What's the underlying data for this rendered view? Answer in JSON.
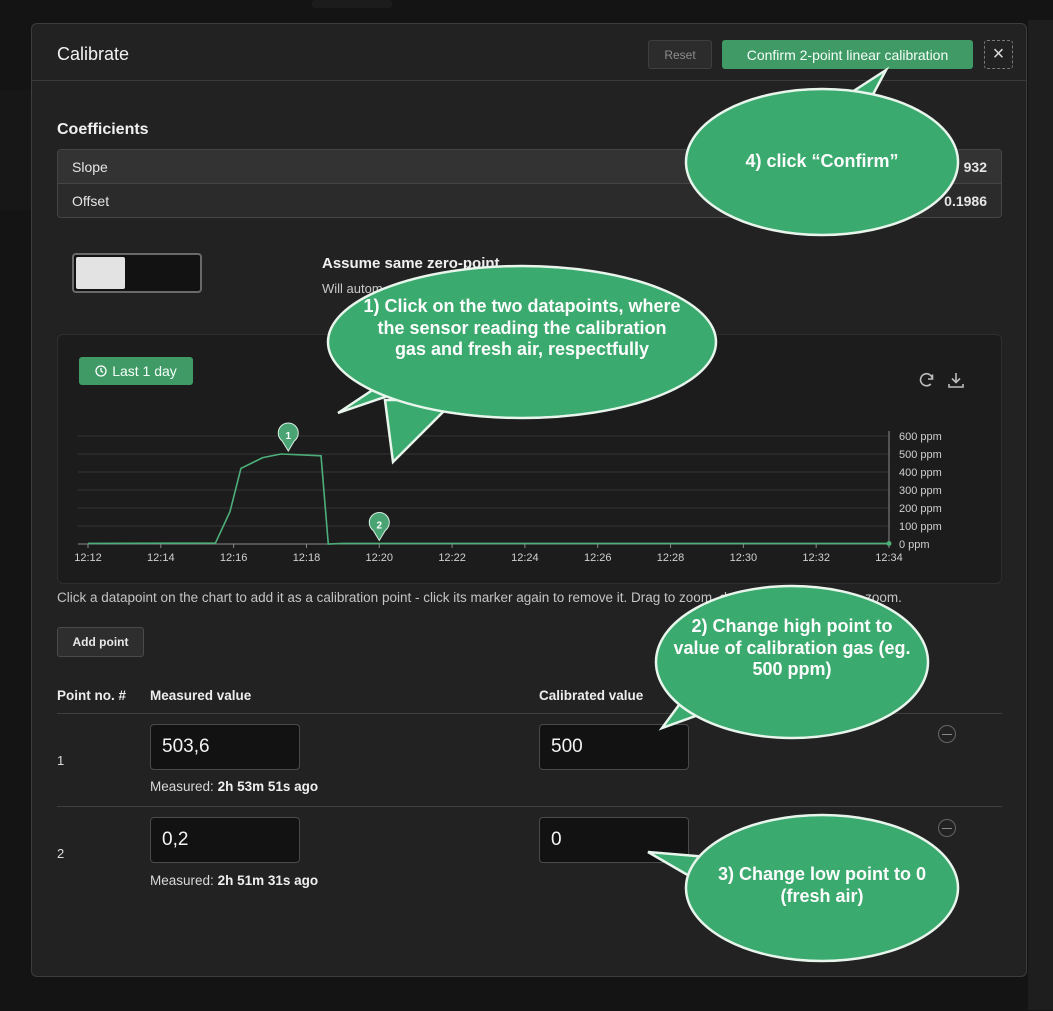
{
  "dialog": {
    "title": "Calibrate",
    "reset_label": "Reset",
    "confirm_label": "Confirm 2-point linear calibration",
    "close_icon": "×"
  },
  "coefficients": {
    "title": "Coefficients",
    "rows": [
      {
        "label": "Slope",
        "value": "932"
      },
      {
        "label": "Offset",
        "value": "0.1986"
      }
    ]
  },
  "zero_point": {
    "title": "Assume same zero-point",
    "description": "Will autom",
    "toggle_on": false
  },
  "chart_panel": {
    "range_label": "Last 1 day",
    "icons": [
      "clock-icon",
      "refresh-icon",
      "download-icon"
    ]
  },
  "chart_data": {
    "type": "line",
    "x_ticks": [
      "12:12",
      "12:14",
      "12:16",
      "12:18",
      "12:20",
      "12:22",
      "12:24",
      "12:26",
      "12:28",
      "12:30",
      "12:32",
      "12:34"
    ],
    "y_ticks": [
      "0 ppm",
      "100 ppm",
      "200 ppm",
      "300 ppm",
      "400 ppm",
      "500 ppm",
      "600 ppm"
    ],
    "ylim": [
      0,
      600
    ],
    "series": [
      {
        "color": "#4caf79",
        "x_minutes": [
          0,
          3.5,
          3.9,
          4.2,
          4.8,
          5.3,
          6.4,
          6.6,
          7.0,
          22
        ],
        "values": [
          3,
          5,
          180,
          420,
          480,
          500,
          490,
          0,
          3,
          3
        ]
      }
    ],
    "markers": [
      {
        "label": "1",
        "x_minutes": 5.5,
        "value": 500
      },
      {
        "label": "2",
        "x_minutes": 8.0,
        "value": 3
      }
    ]
  },
  "hint": "Click a datapoint on the chart to add it as a calibration point - click its marker again to remove it. Drag to zoom, double click to reset the zoom.",
  "add_point_label": "Add point",
  "table": {
    "headers": {
      "no": "Point no. #",
      "measured": "Measured value",
      "calibrated": "Calibrated value"
    },
    "measured_prefix": "Measured:",
    "rows": [
      {
        "no": "1",
        "measured": "503,6",
        "calibrated": "500",
        "ago": "2h 53m 51s ago"
      },
      {
        "no": "2",
        "measured": "0,2",
        "calibrated": "0",
        "ago": "2h 51m 31s ago"
      }
    ]
  },
  "annotations": {
    "step1": "1) Click on the two datapoints, where the sensor reading the calibration gas and fresh air, respectfully",
    "step2": "2) Change high point to value of calibration gas (eg. 500 ppm)",
    "step3": "3) Change low point to 0 (fresh air)",
    "step4": "4) click “Confirm”",
    "fill": "#3aaa6e",
    "stroke": "#e8f5ec"
  }
}
